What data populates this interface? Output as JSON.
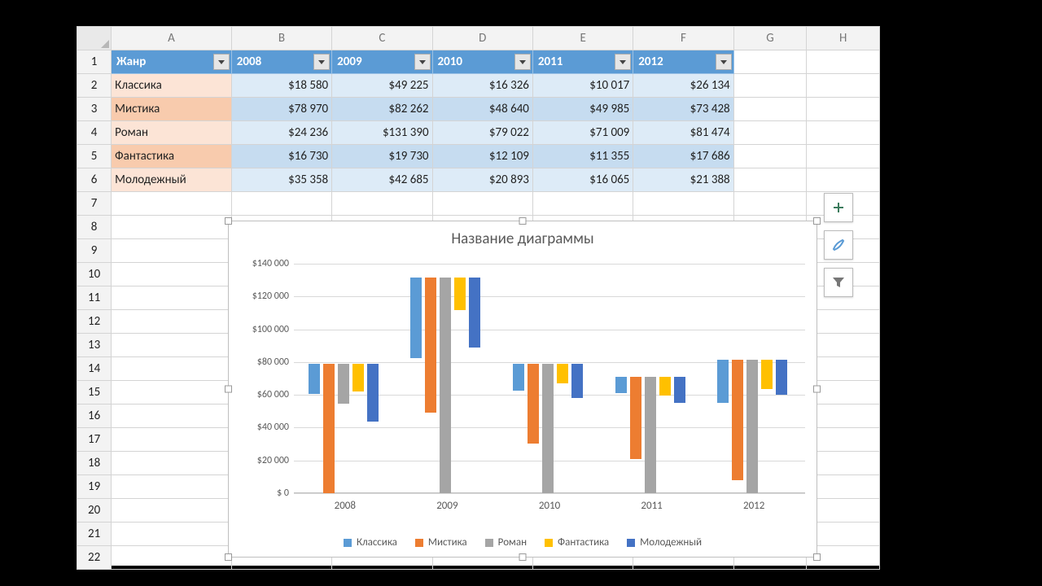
{
  "columns": [
    "A",
    "B",
    "C",
    "D",
    "E",
    "F",
    "G",
    "H"
  ],
  "row_numbers": [
    1,
    2,
    3,
    4,
    5,
    6,
    7,
    8,
    9,
    10,
    11,
    12,
    13,
    14,
    15,
    16,
    17,
    18,
    19,
    20,
    21,
    22
  ],
  "table": {
    "header": [
      "Жанр",
      "2008",
      "2009",
      "2010",
      "2011",
      "2012"
    ],
    "rows": [
      {
        "genre": "Классика",
        "vals": [
          "$18 580",
          "$49 225",
          "$16 326",
          "$10 017",
          "$26 134"
        ]
      },
      {
        "genre": "Мистика",
        "vals": [
          "$78 970",
          "$82 262",
          "$48 640",
          "$49 985",
          "$73 428"
        ]
      },
      {
        "genre": "Роман",
        "vals": [
          "$24 236",
          "$131 390",
          "$79 022",
          "$71 009",
          "$81 474"
        ]
      },
      {
        "genre": "Фантастика",
        "vals": [
          "$16 730",
          "$19 730",
          "$12 109",
          "$11 355",
          "$17 686"
        ]
      },
      {
        "genre": "Молодежный",
        "vals": [
          "$35 358",
          "$42 685",
          "$20 893",
          "$16 065",
          "$21 388"
        ]
      }
    ]
  },
  "chart_tools": {
    "add": "+",
    "style": "brush",
    "filter": "filter"
  },
  "chart_data": {
    "type": "bar",
    "title": "Название диаграммы",
    "categories": [
      "2008",
      "2009",
      "2010",
      "2011",
      "2012"
    ],
    "series": [
      {
        "name": "Классика",
        "color": "#5b9bd5",
        "values": [
          18580,
          49225,
          16326,
          10017,
          26134
        ]
      },
      {
        "name": "Мистика",
        "color": "#ed7d31",
        "values": [
          78970,
          82262,
          48640,
          49985,
          73428
        ]
      },
      {
        "name": "Роман",
        "color": "#a5a5a5",
        "values": [
          24236,
          131390,
          79022,
          71009,
          81474
        ]
      },
      {
        "name": "Фантастика",
        "color": "#ffc000",
        "values": [
          16730,
          19730,
          12109,
          11355,
          17686
        ]
      },
      {
        "name": "Молодежный",
        "color": "#4472c4",
        "values": [
          35358,
          42685,
          20893,
          16065,
          21388
        ]
      }
    ],
    "ylim": [
      0,
      140000
    ],
    "yticks": [
      0,
      20000,
      40000,
      60000,
      80000,
      100000,
      120000,
      140000
    ],
    "ytick_labels": [
      "$ 0",
      "$20 000",
      "$40 000",
      "$60 000",
      "$80 000",
      "$100 000",
      "$120 000",
      "$140 000"
    ],
    "xlabel": "",
    "ylabel": ""
  }
}
